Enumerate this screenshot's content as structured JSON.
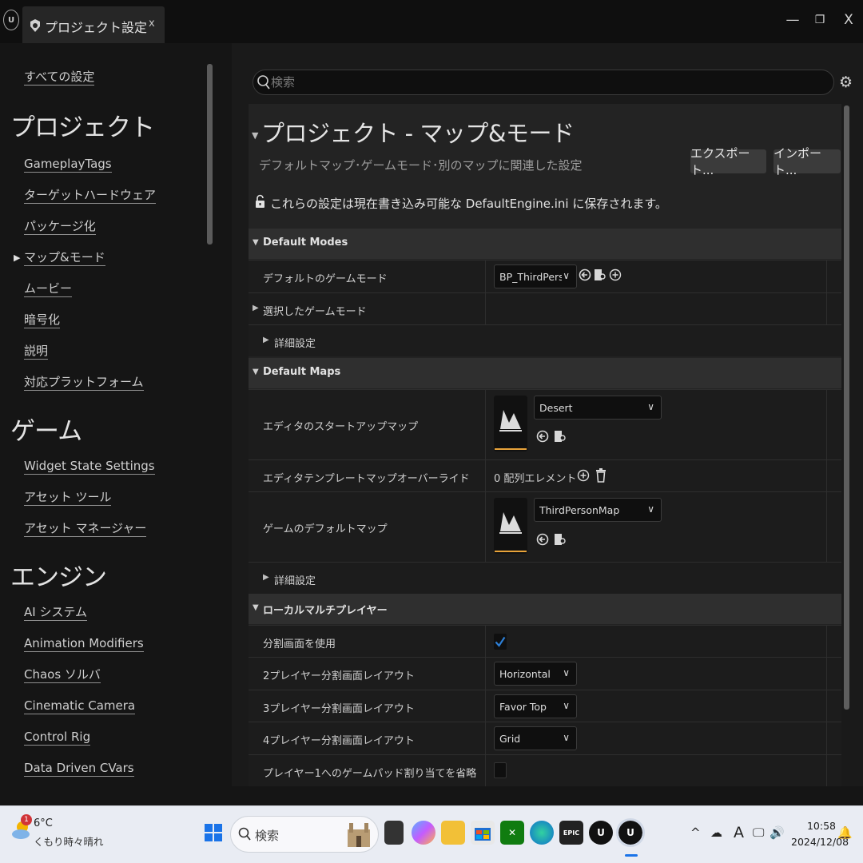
{
  "window": {
    "tab_title": "プロジェクト設定",
    "tab_close": "x",
    "minimize": "—",
    "maximize": "❐",
    "close": "X"
  },
  "nav": {
    "all_settings": "すべての設定",
    "sections": [
      {
        "title": "プロジェクト",
        "items": [
          "GameplayTags",
          "ターゲットハードウェア",
          "パッケージ化",
          "マップ&モード",
          "ムービー",
          "暗号化",
          "説明",
          "対応プラットフォーム"
        ]
      },
      {
        "title": "ゲーム",
        "items": [
          "Widget State Settings",
          "アセット ツール",
          "アセット マネージャー"
        ]
      },
      {
        "title": "エンジン",
        "items": [
          "AI システム",
          "Animation Modifiers",
          "Chaos ソルバ",
          "Cinematic Camera",
          "Control Rig",
          "Data Driven CVars"
        ]
      }
    ],
    "active_item": "マップ&モード"
  },
  "search": {
    "placeholder": "検索"
  },
  "page": {
    "title": "プロジェクト - マップ&モード",
    "description": "デフォルトマップ･ゲームモード･別のマップに関連した設定",
    "export_label": "エクスポート...",
    "import_label": "インポート...",
    "save_note": "これらの設定は現在書き込み可能な DefaultEngine.ini に保存されます。"
  },
  "default_modes": {
    "header": "Default Modes",
    "default_game_mode_label": "デフォルトのゲームモード",
    "default_game_mode_value": "BP_ThirdPersonGa",
    "selected_game_mode_label": "選択したゲームモード",
    "advanced_label": "詳細設定"
  },
  "default_maps": {
    "header": "Default Maps",
    "editor_startup_label": "エディタのスタートアップマップ",
    "editor_startup_value": "Desert",
    "template_override_label": "エディタテンプレートマップオーバーライド",
    "template_override_value": "0 配列エレメント",
    "game_default_label": "ゲームのデフォルトマップ",
    "game_default_value": "ThirdPersonMap",
    "advanced_label": "詳細設定"
  },
  "local_multiplayer": {
    "header": "ローカルマルチプレイヤー",
    "use_splitscreen_label": "分割画面を使用",
    "use_splitscreen_checked": true,
    "two_player_label": "2プレイヤー分割画面レイアウト",
    "two_player_value": "Horizontal",
    "three_player_label": "3プレイヤー分割画面レイアウト",
    "three_player_value": "Favor Top",
    "four_player_label": "4プレイヤー分割画面レイアウト",
    "four_player_value": "Grid",
    "skip_gamepad_label": "プレイヤー1へのゲームパッド割り当てを省略",
    "skip_gamepad_checked": false
  },
  "taskbar": {
    "temperature": "6°C",
    "condition": "くもり時々晴れ",
    "weather_badge": "1",
    "search_label": "検索",
    "time": "10:58",
    "date": "2024/12/08",
    "ime": "A",
    "epic_label": "EPIC"
  },
  "colors": {
    "accent_orange": "#e8a33a",
    "checkbox_blue": "#2d7fd6"
  }
}
